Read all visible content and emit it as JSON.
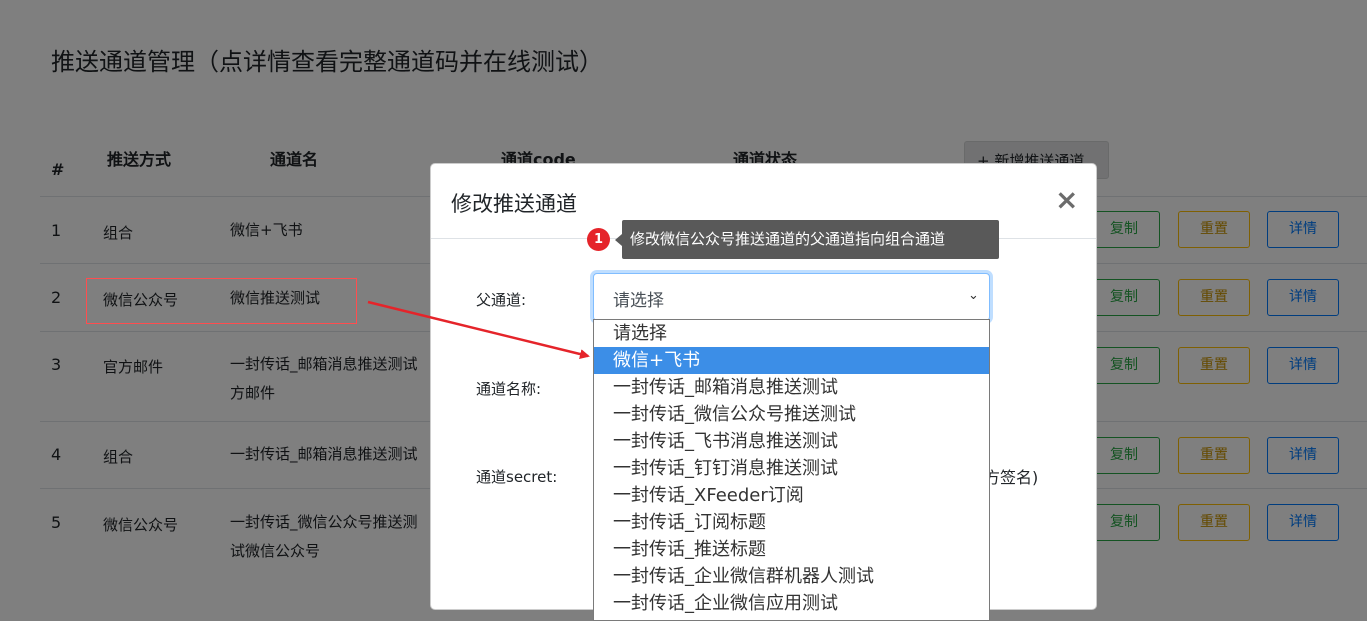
{
  "page": {
    "title": "推送通道管理（点详情查看完整通道码并在线测试）",
    "add_button": "+ 新增推送通道"
  },
  "table": {
    "headers": {
      "num": "#",
      "method": "推送方式",
      "name": "通道名",
      "code": "通道code",
      "status": "通道状态"
    },
    "rows": [
      {
        "idx": "1",
        "method": "组合",
        "name": "微信+飞书"
      },
      {
        "idx": "2",
        "method": "微信公众号",
        "name": "微信推送测试"
      },
      {
        "idx": "3",
        "method": "官方邮件",
        "name": "一封传话_邮箱消息推送测试方邮件"
      },
      {
        "idx": "4",
        "method": "组合",
        "name": "一封传话_邮箱消息推送测试"
      },
      {
        "idx": "5",
        "method": "微信公众号",
        "name": "一封传话_微信公众号推送测试微信公众号"
      }
    ],
    "actions": {
      "copy": "复制",
      "reset": "重置",
      "detail": "详情"
    }
  },
  "modal": {
    "title": "修改推送通道",
    "close": "×",
    "fields": {
      "parent_label": "父通道:",
      "parent_value": "请选择",
      "name_label": "通道名称:",
      "secret_label": "通道secret:",
      "secret_hint": "方签名)"
    }
  },
  "dropdown": {
    "options": [
      "请选择",
      "微信+飞书",
      "一封传话_邮箱消息推送测试",
      "一封传话_微信公众号推送测试",
      "一封传话_飞书消息推送测试",
      "一封传话_钉钉消息推送测试",
      "一封传话_XFeeder订阅",
      "一封传话_订阅标题",
      "一封传话_推送标题",
      "一封传话_企业微信群机器人测试",
      "一封传话_企业微信应用测试"
    ],
    "selected_index": 1
  },
  "annotation": {
    "badge": "1",
    "tooltip": "修改微信公众号推送通道的父通道指向组合通道"
  },
  "colors": {
    "highlight_red": "#e5242a",
    "selected_option": "#3c8ee7",
    "tooltip_bg": "#595959"
  }
}
